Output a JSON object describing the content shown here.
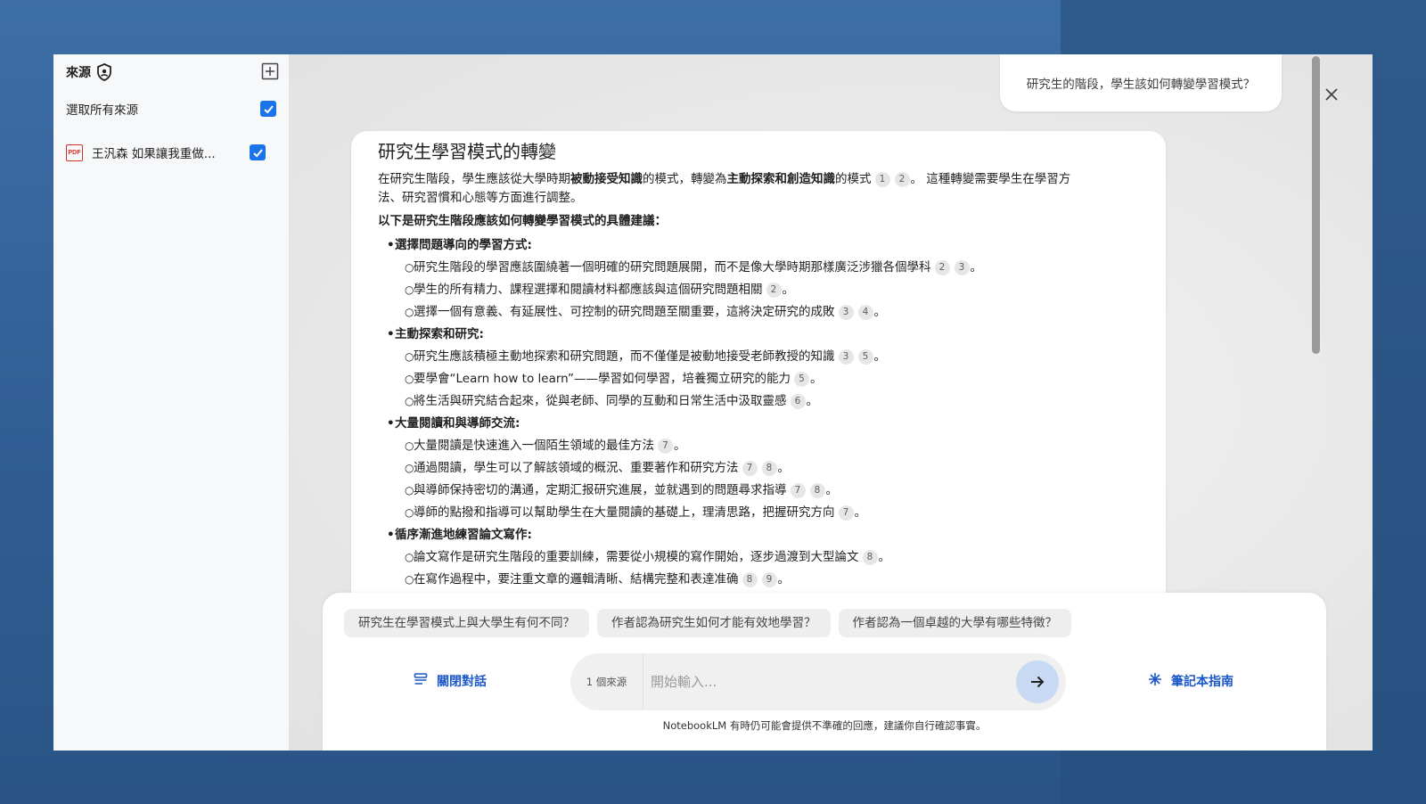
{
  "sidebar": {
    "title": "來源",
    "select_all_label": "選取所有來源",
    "sources": [
      {
        "icon": "pdf-icon",
        "icon_text": "PDF",
        "name": "王汎森 如果讓我重做..."
      }
    ]
  },
  "chat": {
    "user_question": "研究生的階段，學生該如何轉變學習模式？",
    "answer": {
      "title": "研究生學習模式的轉變",
      "intro": {
        "p1": "在研究生階段，學生應該從大學時期",
        "b1": "被動接受知識",
        "p2": "的模式，轉變為",
        "b2": "主動探索和創造知識",
        "p3": "的模式",
        "cites": [
          "1",
          "2"
        ],
        "p4": "。 這種轉變需要學生在學習方",
        "p5": "法、研究習慣和心態等方面進行調整。"
      },
      "lead": "以下是研究生階段應該如何轉變學習模式的具體建議：",
      "sections": [
        {
          "heading": "選擇問題導向的學習方式:",
          "items": [
            {
              "text": "研究生階段的學習應該圍繞著一個明確的研究問題展開，而不是像大學時期那樣廣泛涉獵各個學科",
              "cites": [
                "2",
                "3"
              ]
            },
            {
              "text": "學生的所有精力、課程選擇和閱讀材料都應該與這個研究問題相關",
              "cites": [
                "2"
              ]
            },
            {
              "text": "選擇一個有意義、有延展性、可控制的研究問題至關重要，這將決定研究的成敗",
              "cites": [
                "3",
                "4"
              ]
            }
          ]
        },
        {
          "heading": "主動探索和研究:",
          "items": [
            {
              "text": "研究生應該積極主動地探索和研究問題，而不僅僅是被動地接受老師教授的知識",
              "cites": [
                "3",
                "5"
              ]
            },
            {
              "text": "要學會“Learn how to learn”——學習如何學習，培養獨立研究的能力",
              "cites": [
                "5"
              ]
            },
            {
              "text": "將生活與研究結合起來，從與老師、同學的互動和日常生活中汲取靈感",
              "cites": [
                "6"
              ]
            }
          ]
        },
        {
          "heading": "大量閱讀和與導師交流:",
          "items": [
            {
              "text": "大量閱讀是快速進入一個陌生領域的最佳方法",
              "cites": [
                "7"
              ]
            },
            {
              "text": "通過閱讀，學生可以了解該領域的概況、重要著作和研究方法",
              "cites": [
                "7",
                "8"
              ]
            },
            {
              "text": "與導師保持密切的溝通，定期汇报研究進展，並就遇到的問題尋求指導",
              "cites": [
                "7",
                "8"
              ]
            },
            {
              "text": "導師的點撥和指導可以幫助學生在大量閱讀的基礎上，理清思路，把握研究方向",
              "cites": [
                "7"
              ]
            }
          ]
        },
        {
          "heading": "循序漸進地練習論文寫作:",
          "items": [
            {
              "text": "論文寫作是研究生階段的重要訓練，需要從小規模的寫作開始，逐步過渡到大型論文",
              "cites": [
                "8"
              ]
            },
            {
              "text": "在寫作過程中，要注重文章的邏輯清晰、結構完整和表達准确",
              "cites": [
                "8",
                "9"
              ]
            }
          ]
        }
      ],
      "period": "。"
    },
    "suggestions": [
      "研究生在學習模式上與大學生有何不同？",
      "作者認為研究生如何才能有效地學習？",
      "作者認為一個卓越的大學有哪些特徵？"
    ],
    "close_chat_label": "關閉對話",
    "source_count_label": "1 個來源",
    "input_placeholder": "開始輸入...",
    "guide_label": "筆記本指南",
    "disclaimer": "NotebookLM 有時仍可能會提供不準確的回應，建議你自行確認事實。"
  },
  "colors": {
    "accent": "#1a73e8",
    "link": "#1a57c8",
    "pdf": "#d93025"
  }
}
